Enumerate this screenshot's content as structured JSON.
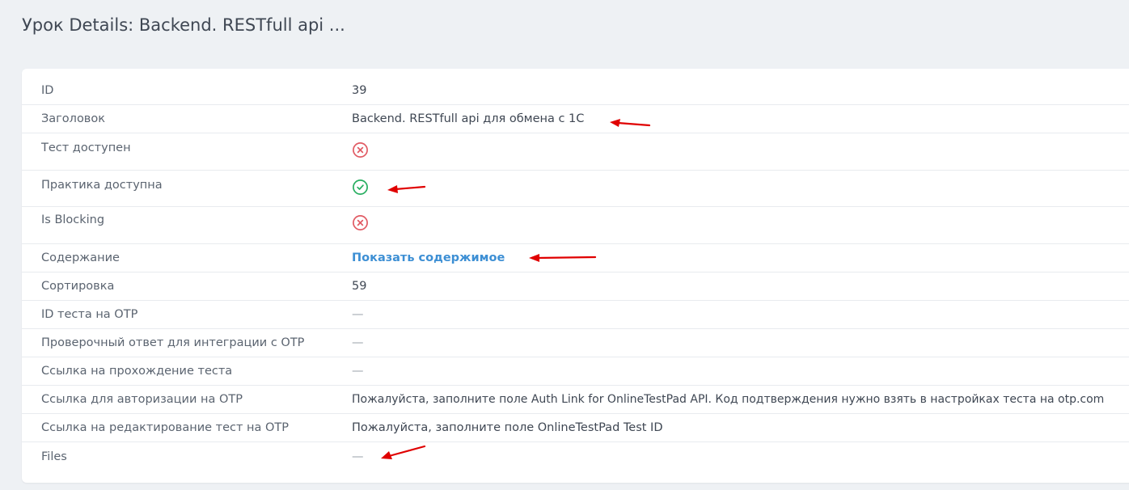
{
  "page": {
    "title": "Урок Details: Backend. RESTfull api ..."
  },
  "rows": [
    {
      "label": "ID",
      "value": "39"
    },
    {
      "label": "Заголовок",
      "value": "Backend. RESTfull api для обмена с 1С"
    },
    {
      "label": "Тест доступен",
      "icon": "x-circle-icon",
      "status": false
    },
    {
      "label": "Практика доступна",
      "icon": "check-circle-icon",
      "status": true
    },
    {
      "label": "Is Blocking",
      "icon": "x-circle-icon",
      "status": false
    },
    {
      "label": "Содержание",
      "link": "Показать содержимое"
    },
    {
      "label": "Сортировка",
      "value": "59"
    },
    {
      "label": "ID теста на OTP",
      "value": "—"
    },
    {
      "label": "Проверочный ответ для интеграции с OTP",
      "value": "—"
    },
    {
      "label": "Ссылка на прохождение теста",
      "value": "—"
    },
    {
      "label": "Ссылка для авторизации на OTP",
      "value": "Пожалуйста, заполните поле Auth Link for OnlineTestPad API. Код подтверждения нужно взять в настройках теста на otp.com"
    },
    {
      "label": "Ссылка на редактирование тест на OTP",
      "value": "Пожалуйста, заполните поле OnlineTestPad Test ID"
    },
    {
      "label": "Files",
      "value": "—"
    }
  ],
  "colors": {
    "background": "#eef1f4",
    "card": "#ffffff",
    "link": "#3d8fd4",
    "status_false": "#e15b64",
    "status_true": "#27ae60",
    "annotation_arrow": "#e00000"
  }
}
